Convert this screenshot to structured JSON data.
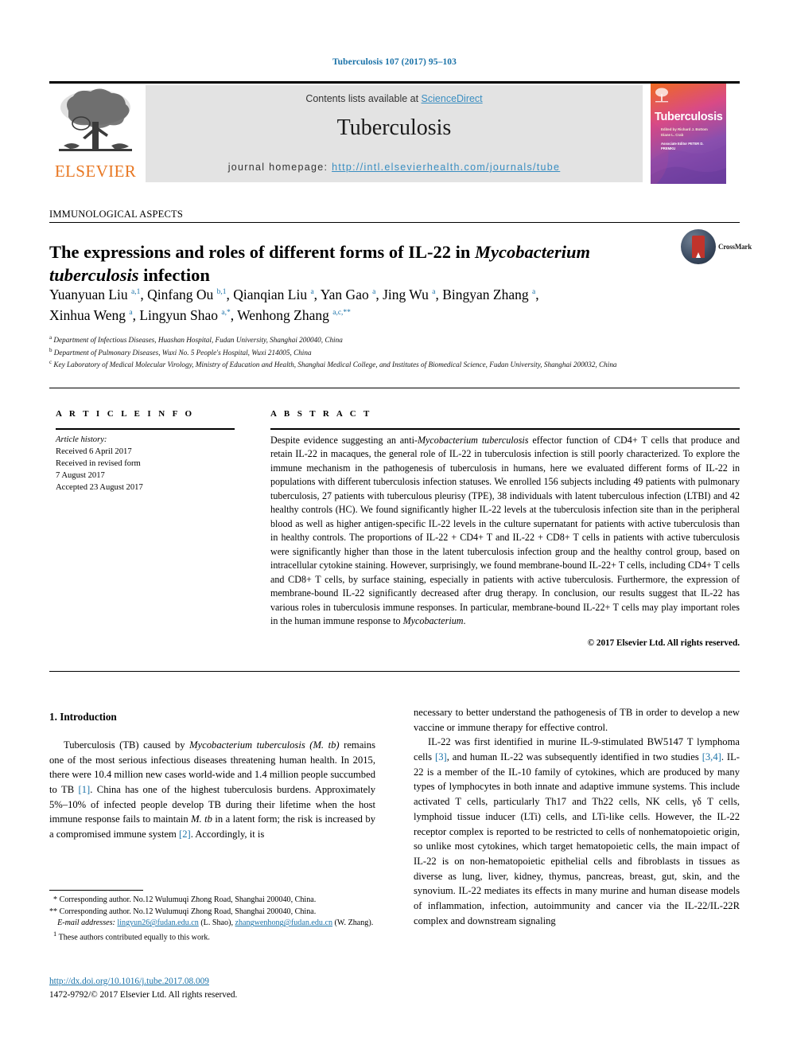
{
  "running_head": "Tuberculosis 107 (2017) 95–103",
  "masthead": {
    "publisher_logo_text": "ELSEVIER",
    "contents_prefix": "Contents lists available at ",
    "contents_link": "ScienceDirect",
    "journal_name": "Tuberculosis",
    "homepage_prefix": "journal homepage: ",
    "homepage_url": "http://intl.elsevierhealth.com/journals/tube",
    "cover": {
      "title": "Tuberculosis",
      "editors_line": "Edited by\nRichard J. Bottom\nDiane L. Crab",
      "assoc_line": "Associate Editor\nPETER D. PREMKU"
    }
  },
  "article": {
    "section_label": "IMMUNOLOGICAL ASPECTS",
    "title_part1": "The expressions and roles of different forms of IL-22 in ",
    "title_italic": "Mycobacterium tuberculosis",
    "title_part2": " infection",
    "crossmark_label": "CrossMark",
    "authors": "Yuanyuan Liu a,1, Qinfang Ou b,1, Qianqian Liu a, Yan Gao a, Jing Wu a, Bingyan Zhang a, Xinhua Weng a, Lingyun Shao a,*, Wenhong Zhang a,c,**",
    "affiliations": [
      "Department of Infectious Diseases, Huashan Hospital, Fudan University, Shanghai 200040, China",
      "Department of Pulmonary Diseases, Wuxi No. 5 People's Hospital, Wuxi 214005, China",
      "Key Laboratory of Medical Molecular Virology, Ministry of Education and Health, Shanghai Medical College, and Institutes of Biomedical Science, Fudan University, Shanghai 200032, China"
    ]
  },
  "article_info": {
    "heading": "A R T I C L E   I N F O",
    "history_label": "Article history:",
    "received": "Received 6 April 2017",
    "revised_label": "Received in revised form",
    "revised_date": "7 August 2017",
    "accepted": "Accepted 23 August 2017"
  },
  "abstract": {
    "heading": "A B S T R A C T",
    "text_1": "Despite evidence suggesting an anti-",
    "italic_1": "Mycobacterium tuberculosis",
    "text_2": " effector function of CD4+ T cells that produce and retain IL-22 in macaques, the general role of IL-22 in tuberculosis infection is still poorly characterized. To explore the immune mechanism in the pathogenesis of tuberculosis in humans, here we evaluated different forms of IL-22 in populations with different tuberculosis infection statuses. We enrolled 156 subjects including 49 patients with pulmonary tuberculosis, 27 patients with tuberculous pleurisy (TPE), 38 individuals with latent tuberculous infection (LTBI) and 42 healthy controls (HC). We found significantly higher IL-22 levels at the tuberculosis infection site than in the peripheral blood as well as higher antigen-specific IL-22 levels in the culture supernatant for patients with active tuberculosis than in healthy controls. The proportions of IL-22 + CD4+ T and IL-22 + CD8+ T cells in patients with active tuberculosis were significantly higher than those in the latent tuberculosis infection group and the healthy control group, based on intracellular cytokine staining. However, surprisingly, we found membrane-bound IL-22+ T cells, including CD4+ T cells and CD8+ T cells, by surface staining, especially in patients with active tuberculosis. Furthermore, the expression of membrane-bound IL-22 significantly decreased after drug therapy. In conclusion, our results suggest that IL-22 has various roles in tuberculosis immune responses. In particular, membrane-bound IL-22+ T cells may play important roles in the human immune response to ",
    "italic_2": "Mycobacterium",
    "text_3": ".",
    "copyright": "© 2017 Elsevier Ltd. All rights reserved."
  },
  "body": {
    "intro_heading": "1. Introduction",
    "left_para_1_a": "Tuberculosis (TB) caused by ",
    "left_para_1_i1": "Mycobacterium tuberculosis (M. tb)",
    "left_para_1_b": " remains one of the most serious infectious diseases threatening human health. In 2015, there were 10.4 million new cases world-wide and 1.4 million people succumbed to TB ",
    "left_ref_1": "[1]",
    "left_para_1_c": ". China has one of the highest tuberculosis burdens. Approximately 5%–10% of infected people develop TB during their lifetime when the host immune response fails to maintain ",
    "left_para_1_i2": "M. tb",
    "left_para_1_d": " in a latent form; the risk is increased by a compromised immune system ",
    "left_ref_2": "[2]",
    "left_para_1_e": ". Accordingly, it is",
    "right_para_1": "necessary to better understand the pathogenesis of TB in order to develop a new vaccine or immune therapy for effective control.",
    "right_para_2_a": "IL-22 was first identified in murine IL-9-stimulated BW5147 T lymphoma cells ",
    "right_ref_3": "[3]",
    "right_para_2_b": ", and human IL-22 was subsequently identified in two studies ",
    "right_ref_34": "[3,4]",
    "right_para_2_c": ". IL-22 is a member of the IL-10 family of cytokines, which are produced by many types of lymphocytes in both innate and adaptive immune systems. This include activated T cells, particularly Th17 and Th22 cells, NK cells, γδ T cells, lymphoid tissue inducer (LTi) cells, and LTi-like cells. However, the IL-22 receptor complex is reported to be restricted to cells of nonhematopoietic origin, so unlike most cytokines, which target hematopoietic cells, the main impact of IL-22 is on non-hematopoietic epithelial cells and fibroblasts in tissues as diverse as lung, liver, kidney, thymus, pancreas, breast, gut, skin, and the synovium. IL-22 mediates its effects in many murine and human disease models of inflammation, infection, autoimmunity and cancer via the IL-22/IL-22R complex and downstream signaling"
  },
  "footnotes": {
    "corr_1": "* Corresponding author. No.12 Wulumuqi Zhong Road, Shanghai 200040, China.",
    "corr_2": "** Corresponding author. No.12 Wulumuqi Zhong Road, Shanghai 200040, China.",
    "email_label": "E-mail addresses:",
    "email_1": "lingyun26@fudan.edu.cn",
    "email_1_owner": " (L. Shao), ",
    "email_2": "zhangwenhong@fudan.edu.cn",
    "email_2_owner": " (W. Zhang).",
    "equal_contrib": "These authors contributed equally to this work.",
    "doi": "http://dx.doi.org/10.1016/j.tube.2017.08.009",
    "issn": "1472-9792/© 2017 Elsevier Ltd. All rights reserved."
  },
  "colors": {
    "link_blue": "#1a72a8",
    "sciencedirect_blue": "#3a8ec1",
    "elsevier_orange": "#E87722",
    "band_gray": "#e3e3e3"
  }
}
